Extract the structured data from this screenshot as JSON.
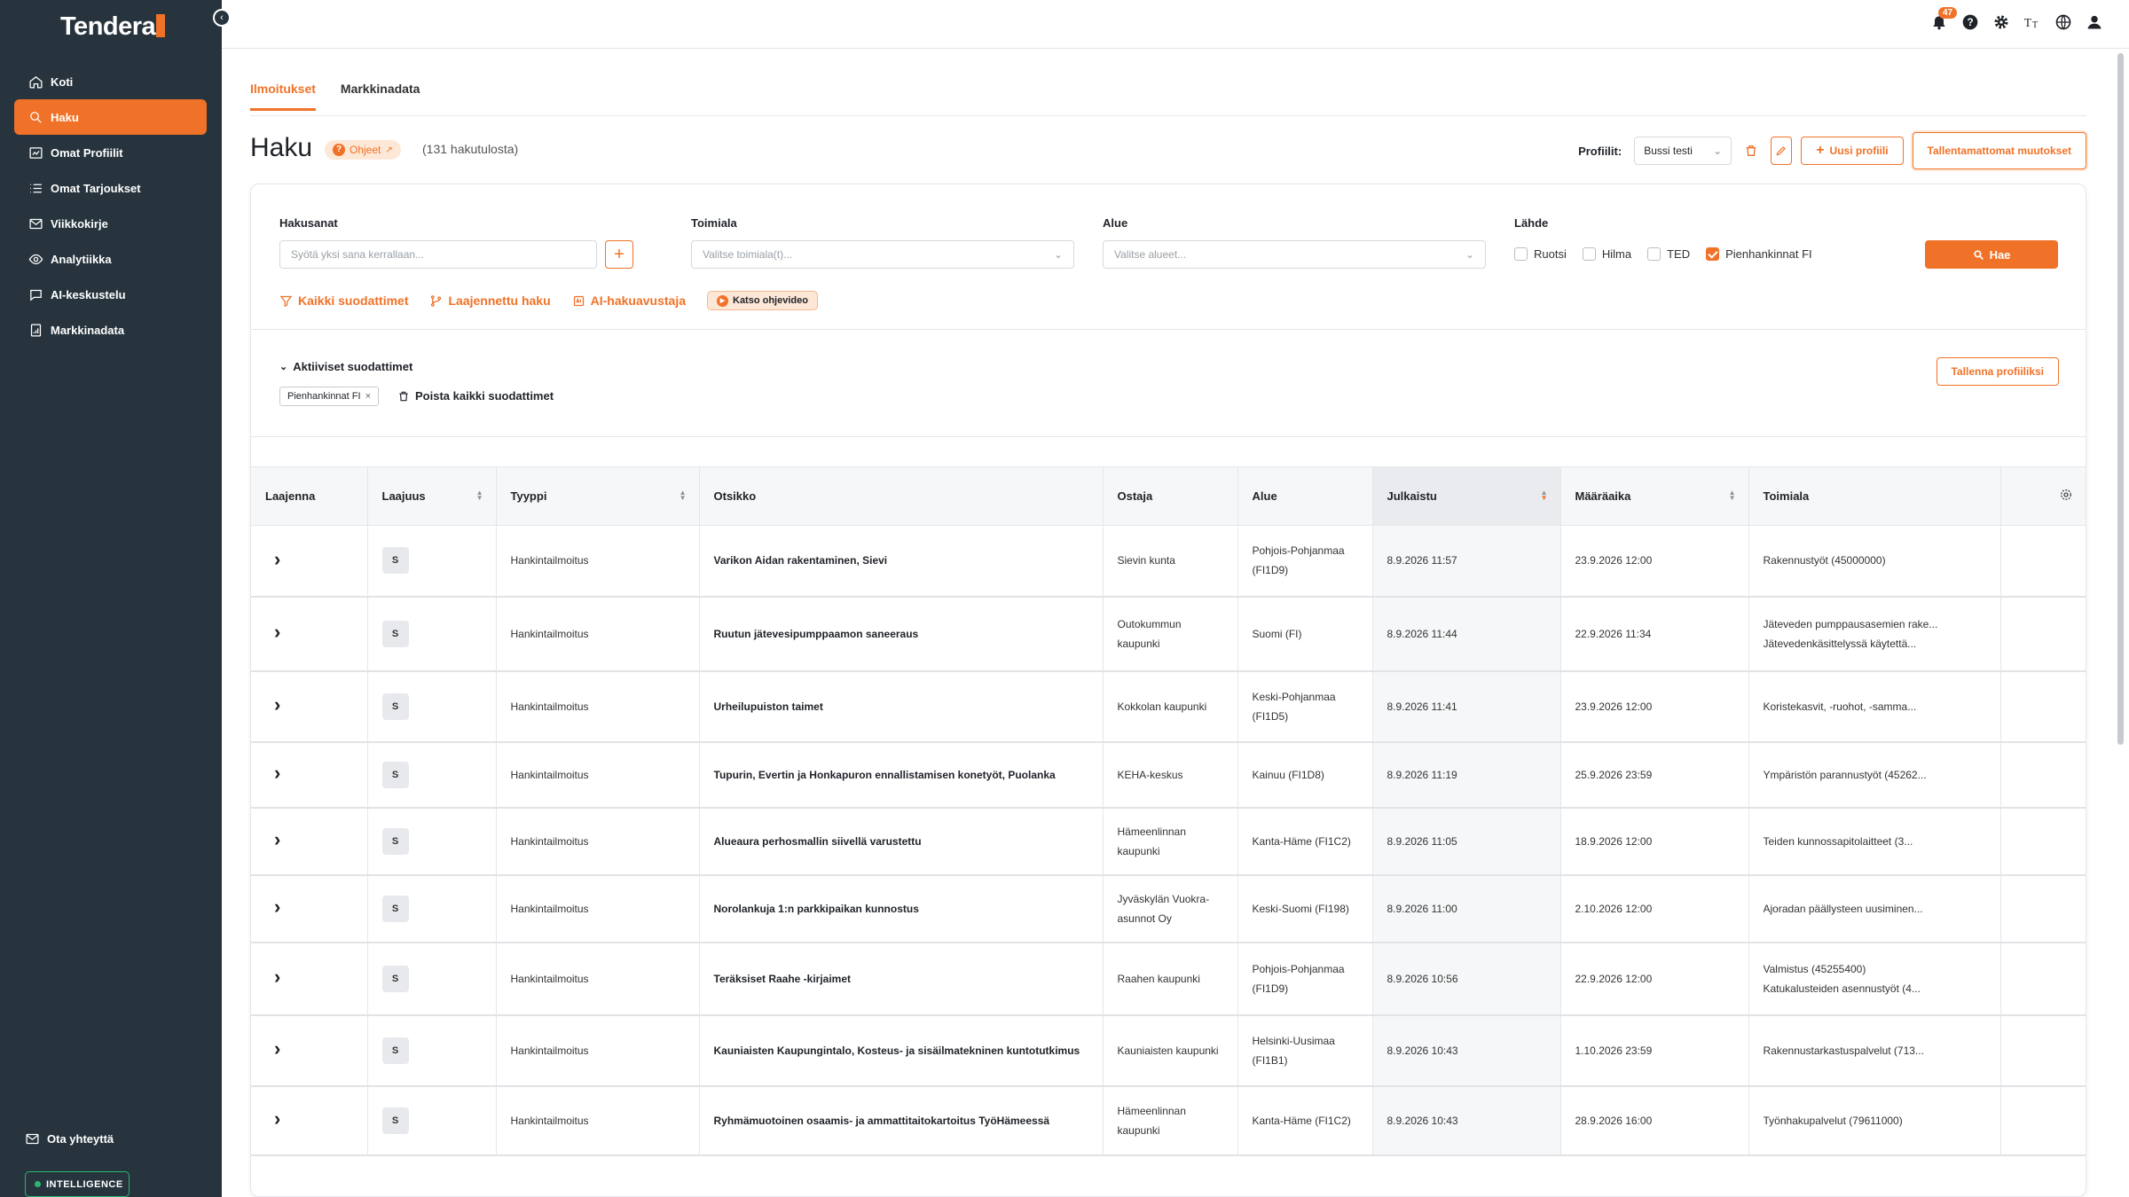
{
  "brand": {
    "name": "Tendera",
    "accent": "#f07228",
    "sidebar_bg": "#27343d"
  },
  "sidebar": {
    "items": [
      {
        "label": "Koti",
        "icon": "home-icon",
        "active": false
      },
      {
        "label": "Haku",
        "icon": "search-icon",
        "active": true
      },
      {
        "label": "Omat Profiilit",
        "icon": "chart-icon",
        "active": false
      },
      {
        "label": "Omat Tarjoukset",
        "icon": "list-icon",
        "active": false
      },
      {
        "label": "Viikkokirje",
        "icon": "mail-icon",
        "active": false
      },
      {
        "label": "Analytiikka",
        "icon": "eye-icon",
        "active": false
      },
      {
        "label": "AI-keskustelu",
        "icon": "chat-icon",
        "active": false
      },
      {
        "label": "Markkinadata",
        "icon": "report-icon",
        "active": false
      }
    ],
    "contact": "Ota yhteyttä",
    "intelligence": "INTELLIGENCE"
  },
  "topbar": {
    "notification_count": "47"
  },
  "tabs": [
    {
      "label": "Ilmoitukset",
      "active": true
    },
    {
      "label": "Markkinadata",
      "active": false
    }
  ],
  "page": {
    "title": "Haku",
    "help": "Ohjeet",
    "result_count": "(131 hakutulosta)"
  },
  "profile": {
    "label": "Profiilit:",
    "selected": "Bussi testi",
    "new_profile": "Uusi profiili",
    "unsaved": "Tallentamattomat muutokset"
  },
  "filters": {
    "keywords": {
      "label": "Hakusanat",
      "placeholder": "Syötä yksi sana kerrallaan..."
    },
    "industry": {
      "label": "Toimiala",
      "placeholder": "Valitse toimiala(t)..."
    },
    "region": {
      "label": "Alue",
      "placeholder": "Valitse alueet..."
    },
    "source": {
      "label": "Lähde",
      "options": [
        {
          "label": "Ruotsi",
          "checked": false
        },
        {
          "label": "Hilma",
          "checked": false
        },
        {
          "label": "TED",
          "checked": false
        },
        {
          "label": "Pienhankinnat FI",
          "checked": true
        }
      ]
    },
    "search_button": "Hae",
    "all_filters": "Kaikki suodattimet",
    "advanced": "Laajennettu haku",
    "ai_assistant": "AI-hakuavustaja",
    "video": "Katso ohjevideo",
    "active_filters": "Aktiiviset suodattimet",
    "chip": "Pienhankinnat FI",
    "clear_all": "Poista kaikki suodattimet",
    "save_profile": "Tallenna profiiliksi"
  },
  "table": {
    "headers": [
      "Laajenna",
      "Laajuus",
      "Tyyppi",
      "Otsikko",
      "Ostaja",
      "Alue",
      "Julkaistu",
      "Määräaika",
      "Toimiala"
    ],
    "rows": [
      {
        "scope": "S",
        "type": "Hankintailmoitus",
        "title": "Varikon Aidan rakentaminen, Sievi",
        "buyer": "Sievin kunta",
        "region": "Pohjois-Pohjanmaa (FI1D9)",
        "published": "8.9.2026 11:57",
        "deadline": "23.9.2026 12:00",
        "industry": [
          "Rakennustyöt (45000000)"
        ]
      },
      {
        "scope": "S",
        "type": "Hankintailmoitus",
        "title": "Ruutun jätevesipumppaamon saneeraus",
        "buyer": "Outokummun kaupunki",
        "region": "Suomi (FI)",
        "published": "8.9.2026 11:44",
        "deadline": "22.9.2026 11:34",
        "industry": [
          "Jäteveden pumppausasemien rake...",
          "Jätevedenkäsittelyssä käytettä..."
        ]
      },
      {
        "scope": "S",
        "type": "Hankintailmoitus",
        "title": "Urheilupuiston taimet",
        "buyer": "Kokkolan kaupunki",
        "region": "Keski-Pohjanmaa (FI1D5)",
        "published": "8.9.2026 11:41",
        "deadline": "23.9.2026 12:00",
        "industry": [
          "Koristekasvit, -ruohot, -samma..."
        ]
      },
      {
        "scope": "S",
        "type": "Hankintailmoitus",
        "title": "Tupurin, Evertin ja Honkapuron ennallistamisen konetyöt, Puolanka",
        "buyer": "KEHA-keskus",
        "region": "Kainuu (FI1D8)",
        "published": "8.9.2026 11:19",
        "deadline": "25.9.2026 23:59",
        "industry": [
          "Ympäristön parannustyöt (45262..."
        ]
      },
      {
        "scope": "S",
        "type": "Hankintailmoitus",
        "title": "Alueaura perhosmallin siivellä varustettu",
        "buyer": "Hämeenlinnan kaupunki",
        "region": "Kanta-Häme (FI1C2)",
        "published": "8.9.2026 11:05",
        "deadline": "18.9.2026 12:00",
        "industry": [
          "Teiden kunnossapitolaitteet (3..."
        ]
      },
      {
        "scope": "S",
        "type": "Hankintailmoitus",
        "title": "Norolankuja 1:n parkkipaikan kunnostus",
        "buyer": "Jyväskylän Vuokra-asunnot Oy",
        "region": "Keski-Suomi (FI198)",
        "published": "8.9.2026 11:00",
        "deadline": "2.10.2026 12:00",
        "industry": [
          "Ajoradan päällysteen uusiminen..."
        ]
      },
      {
        "scope": "S",
        "type": "Hankintailmoitus",
        "title": "Teräksiset Raahe -kirjaimet",
        "buyer": "Raahen kaupunki",
        "region": "Pohjois-Pohjanmaa (FI1D9)",
        "published": "8.9.2026 10:56",
        "deadline": "22.9.2026 12:00",
        "industry": [
          "Valmistus (45255400)",
          "Katukalusteiden asennustyöt (4..."
        ]
      },
      {
        "scope": "S",
        "type": "Hankintailmoitus",
        "title": "Kauniaisten Kaupungintalo, Kosteus- ja sisäilmatekninen kuntotutkimus",
        "buyer": "Kauniaisten kaupunki",
        "region": "Helsinki-Uusimaa (FI1B1)",
        "published": "8.9.2026 10:43",
        "deadline": "1.10.2026 23:59",
        "industry": [
          "Rakennustarkastuspalvelut (713..."
        ]
      },
      {
        "scope": "S",
        "type": "Hankintailmoitus",
        "title": "Ryhmämuotoinen osaamis- ja ammattitaitokartoitus TyöHämeessä",
        "buyer": "Hämeenlinnan kaupunki",
        "region": "Kanta-Häme (FI1C2)",
        "published": "8.9.2026 10:43",
        "deadline": "28.9.2026 16:00",
        "industry": [
          "Työnhakupalvelut (79611000)"
        ]
      }
    ]
  }
}
